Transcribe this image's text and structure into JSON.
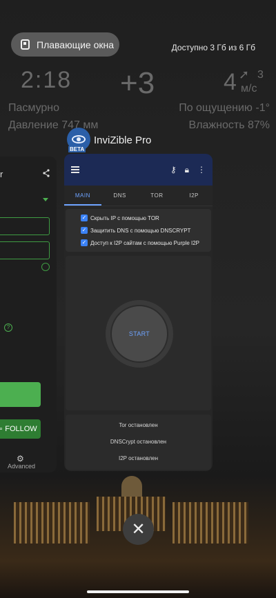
{
  "floating_windows": {
    "label": "Плавающие окна",
    "icon": "floating-window-icon"
  },
  "storage": {
    "text": "Доступно 3 Гб из 6 Гб"
  },
  "weather": {
    "time": "2:18",
    "temperature": "+3",
    "degree": "4",
    "wind_value": "3",
    "wind_unit": "м/с",
    "condition": "Пасмурно",
    "pressure": "Давление 747 мм",
    "feels_like": "По ощущению -1°",
    "humidity": "Влажность 87%"
  },
  "app": {
    "title": "InviZible Pro",
    "icon": "invizible-eye-icon",
    "badge": "BETA"
  },
  "left_card": {
    "partial_text": "r",
    "follow_label": "FOLLOW",
    "advanced_label": "Advanced",
    "accent_color": "#4caf50"
  },
  "toolbar": {
    "icons": [
      "menu-icon",
      "key-icon",
      "lock-icon",
      "more-vert-icon"
    ],
    "color": "#1c2a55"
  },
  "tabs": [
    {
      "label": "MAIN",
      "active": true
    },
    {
      "label": "DNS",
      "active": false
    },
    {
      "label": "TOR",
      "active": false
    },
    {
      "label": "I2P",
      "active": false
    }
  ],
  "options": [
    {
      "label": "Скрыть IP с помощью TOR",
      "checked": true
    },
    {
      "label": "Защитить DNS с помощью DNSCRYPT",
      "checked": true
    },
    {
      "label": "Доступ к I2P сайтам с помощью Purple I2P",
      "checked": true
    }
  ],
  "start_button": {
    "label": "START",
    "color": "#6ea3ff"
  },
  "statuses": [
    {
      "label": "Tor остановлен"
    },
    {
      "label": "DNSCrypt остановлен"
    },
    {
      "label": "I2P остановлен"
    }
  ],
  "close": {
    "icon": "close-icon"
  }
}
